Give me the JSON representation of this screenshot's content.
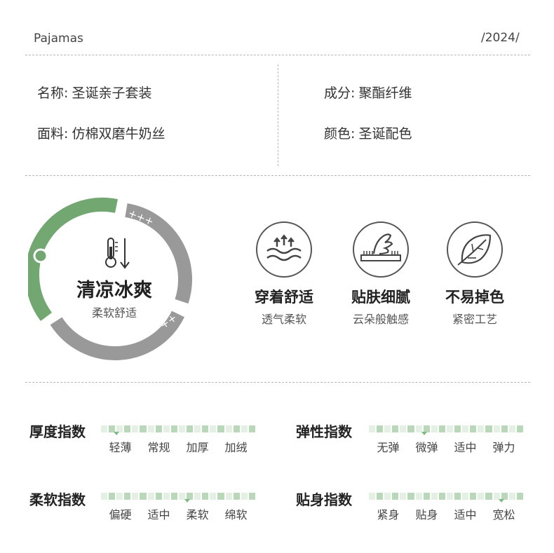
{
  "header": {
    "brand": "Pajamas",
    "year": "/2024/"
  },
  "info": {
    "name_label": "名称:",
    "name_value": "圣诞亲子套装",
    "fabric_label": "面料:",
    "fabric_value": "仿棉双磨牛奶丝",
    "composition_label": "成分:",
    "composition_value": "聚酯纤维",
    "color_label": "颜色:",
    "color_value": "圣诞配色"
  },
  "ring": {
    "title": "清凉冰爽",
    "subtitle": "柔软舒适",
    "plus_top": "+++",
    "plus_bottom": "++",
    "green_color": "#72a772",
    "gray_color": "#999999"
  },
  "features": [
    {
      "icon": "wave-breathable-icon",
      "title": "穿着舒适",
      "sub": "透气柔软"
    },
    {
      "icon": "hand-touch-fabric-icon",
      "title": "贴肤细腻",
      "sub": "云朵般触感"
    },
    {
      "icon": "leaf-icon",
      "title": "不易掉色",
      "sub": "紧密工艺"
    }
  ],
  "indices": [
    {
      "label": "厚度指数",
      "options": [
        "轻薄",
        "常规",
        "加厚",
        "加绒"
      ],
      "level": 0.1
    },
    {
      "label": "弹性指数",
      "options": [
        "无弹",
        "微弹",
        "适中",
        "弹力"
      ],
      "level": 0.36
    },
    {
      "label": "柔软指数",
      "options": [
        "偏硬",
        "适中",
        "柔软",
        "绵软"
      ],
      "level": 0.56
    },
    {
      "label": "贴身指数",
      "options": [
        "紧身",
        "贴身",
        "适中",
        "宽松"
      ],
      "level": 0.86
    }
  ],
  "colors": {
    "bar_light": "#e3f0e3",
    "bar_dark": "#b9d8b9",
    "marker": "#7fb981"
  }
}
